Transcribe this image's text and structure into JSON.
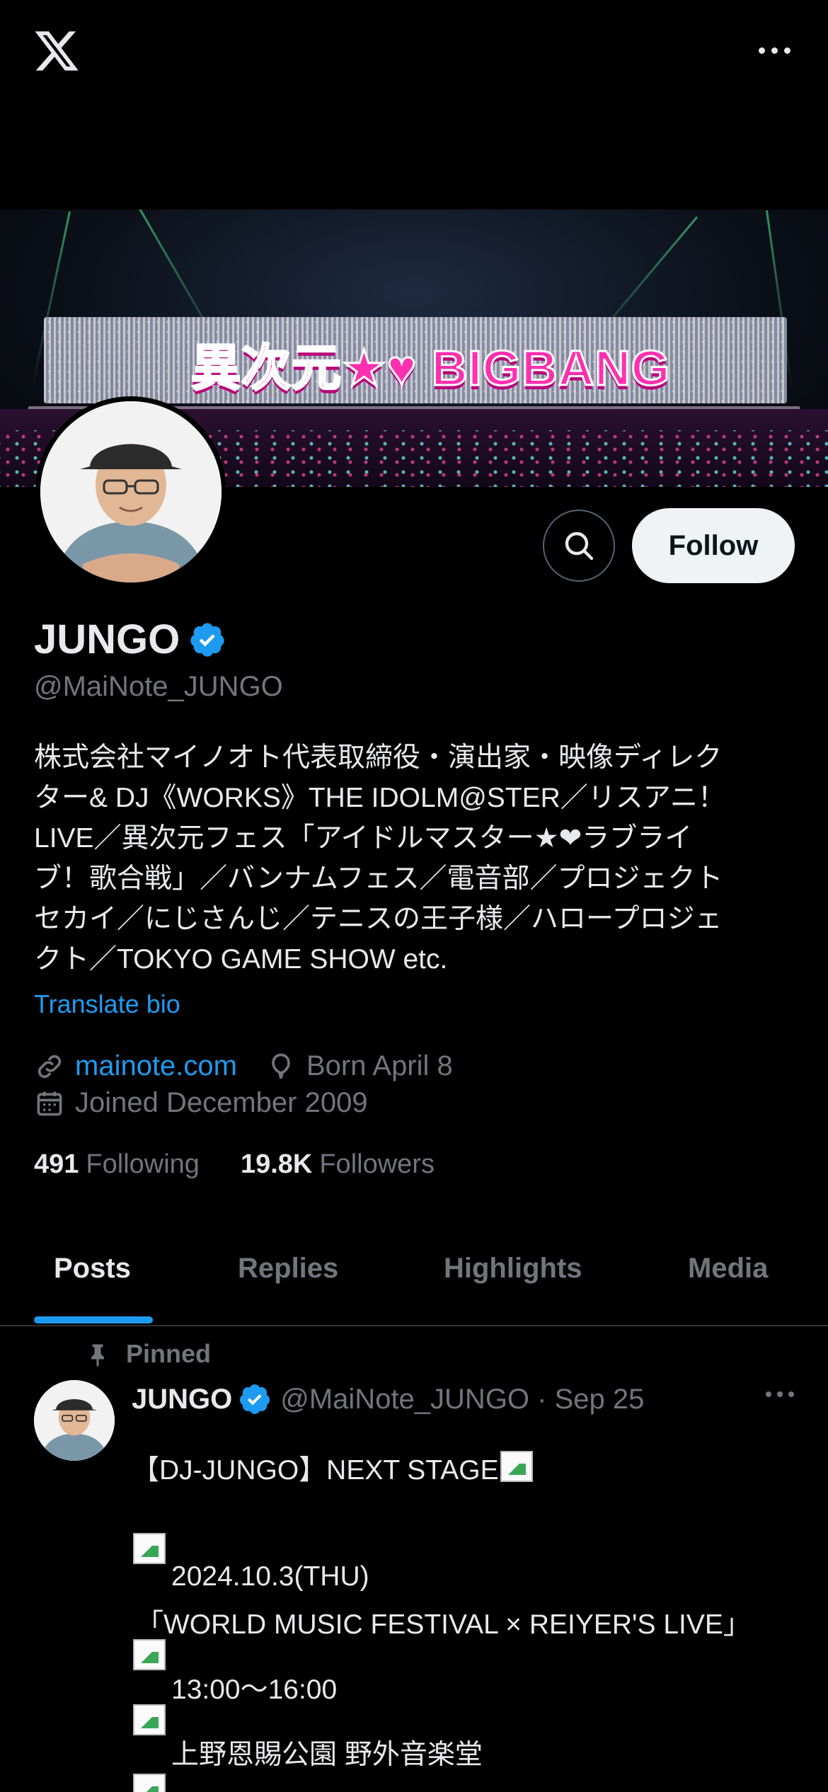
{
  "topbar": {
    "logo_icon": "x-logo-icon",
    "more_icon": "more-horizontal-icon"
  },
  "banner": {
    "title": "異次元★♥ BIGBANG"
  },
  "profile": {
    "display_name": "JUNGO",
    "verified": true,
    "handle": "@MaiNote_JUNGO",
    "follow_label": "Follow",
    "bio": "株式会社マイノオト代表取締役・演出家・映像ディレク\nター& DJ《WORKS》THE IDOLM@STER／リスアニ！\nLIVE／異次元フェス「アイドルマスター★❤ラブライ\nブ！歌合戦」／バンナムフェス／電音部／プロジェクト\nセカイ／にじさんじ／テニスの王子様／ハロープロジェ\nクト／TOKYO GAME SHOW etc.",
    "translate_label": "Translate bio",
    "website": "mainote.com",
    "birthday": "Born April 8",
    "joined": "Joined December 2009",
    "following_count": "491",
    "following_label": "Following",
    "followers_count": "19.8K",
    "followers_label": "Followers"
  },
  "tabs": [
    "Posts",
    "Replies",
    "Highlights",
    "Media"
  ],
  "active_tab": "Posts",
  "post": {
    "pinned_label": "Pinned",
    "author": "JUNGO",
    "handle_date": "@MaiNote_JUNGO · Sep 25",
    "lines": [
      "【DJ-JUNGO】NEXT STAGE",
      "2024.10.3(THU)",
      "「WORLD MUSIC FESTIVAL × REIYER'S LIVE」",
      "13:00〜16:00",
      "上野恩賜公園 野外音楽堂"
    ]
  },
  "colors": {
    "accent": "#1d9bf0",
    "muted": "#71767b",
    "text": "#e7e9ea",
    "background": "#000000"
  }
}
